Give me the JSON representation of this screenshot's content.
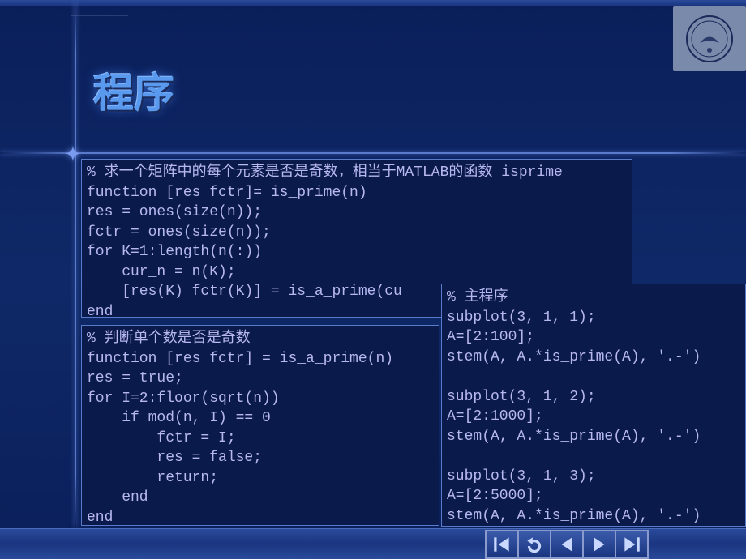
{
  "meta": {
    "small_header": "——————————"
  },
  "title": "程序",
  "logo": {
    "alt": "西安电子科技大学 seal"
  },
  "code": {
    "box1": "% 求一个矩阵中的每个元素是否是奇数，相当于MATLAB的函数 isprime\nfunction [res fctr]= is_prime(n)\nres = ones(size(n));\nfctr = ones(size(n));\nfor K=1:length(n(:))\n    cur_n = n(K);\n    [res(K) fctr(K)] = is_a_prime(cu\nend",
    "box2": "% 判断单个数是否是奇数\nfunction [res fctr] = is_a_prime(n)\nres = true;\nfor I=2:floor(sqrt(n))\n    if mod(n, I) == 0\n        fctr = I;\n        res = false;\n        return;\n    end\nend",
    "box3": "% 主程序\nsubplot(3, 1, 1);\nA=[2:100];\nstem(A, A.*is_prime(A), '.-')\n\nsubplot(3, 1, 2);\nA=[2:1000];\nstem(A, A.*is_prime(A), '.-')\n\nsubplot(3, 1, 3);\nA=[2:5000];\nstem(A, A.*is_prime(A), '.-')"
  },
  "nav": {
    "first": "first-slide",
    "return": "return",
    "prev": "previous-slide",
    "next": "next-slide",
    "last": "last-slide"
  }
}
